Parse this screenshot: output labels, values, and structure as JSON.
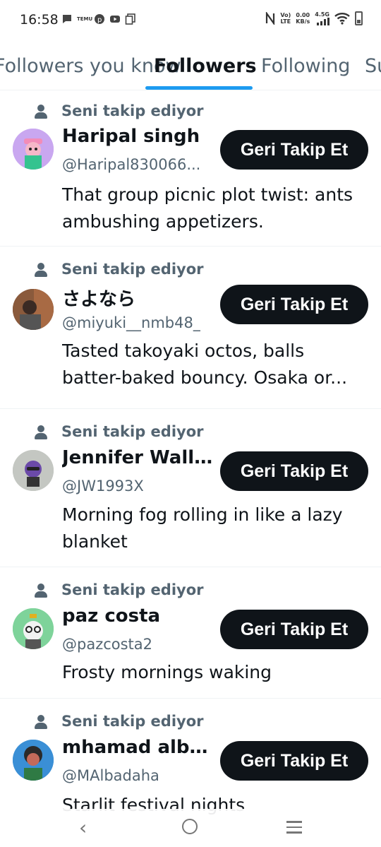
{
  "status_bar": {
    "time": "16:58",
    "temu_label": "TEMU",
    "network_vo": "Vo)",
    "network_lte": "LTE",
    "speed_value": "0.00",
    "speed_unit": "KB/s",
    "signal_label": "4.5G"
  },
  "tabs": [
    {
      "label": "Followers you know",
      "active": false
    },
    {
      "label": "Followers",
      "active": true
    },
    {
      "label": "Following",
      "active": false
    },
    {
      "label": "Subscriptions",
      "active": false
    }
  ],
  "followers": [
    {
      "context": "Seni takip ediyor",
      "name": "Haripal singh",
      "handle": "@Haripal830066...",
      "button": "Geri Takip Et",
      "bio": "That group picnic plot twist: ants ambushing appetizers.",
      "avatar_color": "#c9a7f0"
    },
    {
      "context": "Seni takip ediyor",
      "name": "さよなら",
      "handle": "@miyuki__nmb48_",
      "button": "Geri Takip Et",
      "bio": "Tasted takoyaki octos, balls batter-baked bouncy. Osaka or...",
      "avatar_color": "#6b4a3a"
    },
    {
      "context": "Seni takip ediyor",
      "name": "Jennifer Wallace",
      "handle": "@JW1993X",
      "button": "Geri Takip Et",
      "bio": "Morning fog rolling in like a lazy blanket",
      "avatar_color": "#b9bdb8"
    },
    {
      "context": "Seni takip ediyor",
      "name": "paz costa",
      "handle": "@pazcosta2",
      "button": "Geri Takip Et",
      "bio": "Frosty mornings waking",
      "avatar_color": "#7ed39a"
    },
    {
      "context": "Seni takip ediyor",
      "name": "mhamad albad...",
      "handle": "@MAlbadaha",
      "button": "Geri Takip Et",
      "bio": "Starlit festival nights",
      "avatar_color": "#3a8fd6"
    }
  ]
}
